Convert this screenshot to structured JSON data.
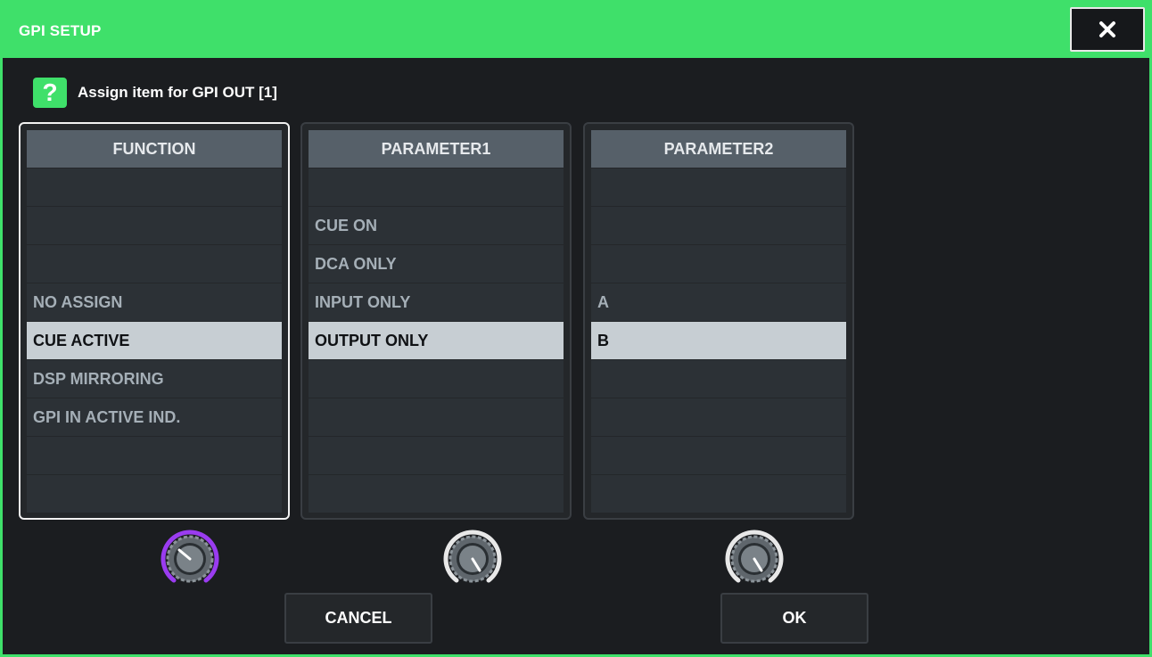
{
  "window": {
    "title": "GPI SETUP",
    "accent": "#3fe06a"
  },
  "close_icon": "close-icon",
  "help": {
    "icon": "?",
    "text": "Assign item for GPI OUT [1]"
  },
  "columns": [
    {
      "header": "FUNCTION",
      "rows": [
        "",
        "",
        "",
        "NO ASSIGN",
        "CUE ACTIVE",
        "DSP MIRRORING",
        "GPI IN ACTIVE IND.",
        "",
        ""
      ],
      "selected_index": 4,
      "focused": true
    },
    {
      "header": "PARAMETER1",
      "rows": [
        "",
        "CUE ON",
        "DCA ONLY",
        "INPUT ONLY",
        "OUTPUT ONLY",
        "",
        "",
        "",
        ""
      ],
      "selected_index": 4,
      "focused": false
    },
    {
      "header": "PARAMETER2",
      "rows": [
        "",
        "",
        "",
        "A",
        "B",
        "",
        "",
        "",
        ""
      ],
      "selected_index": 4,
      "focused": false
    }
  ],
  "knobs": [
    {
      "name": "function-knob",
      "active": true,
      "ring_color": "#9a3cf0"
    },
    {
      "name": "parameter1-knob",
      "active": false,
      "ring_color": "#e8e8e8"
    },
    {
      "name": "parameter2-knob",
      "active": false,
      "ring_color": "#e8e8e8"
    }
  ],
  "buttons": {
    "cancel": "CANCEL",
    "ok": "OK"
  }
}
